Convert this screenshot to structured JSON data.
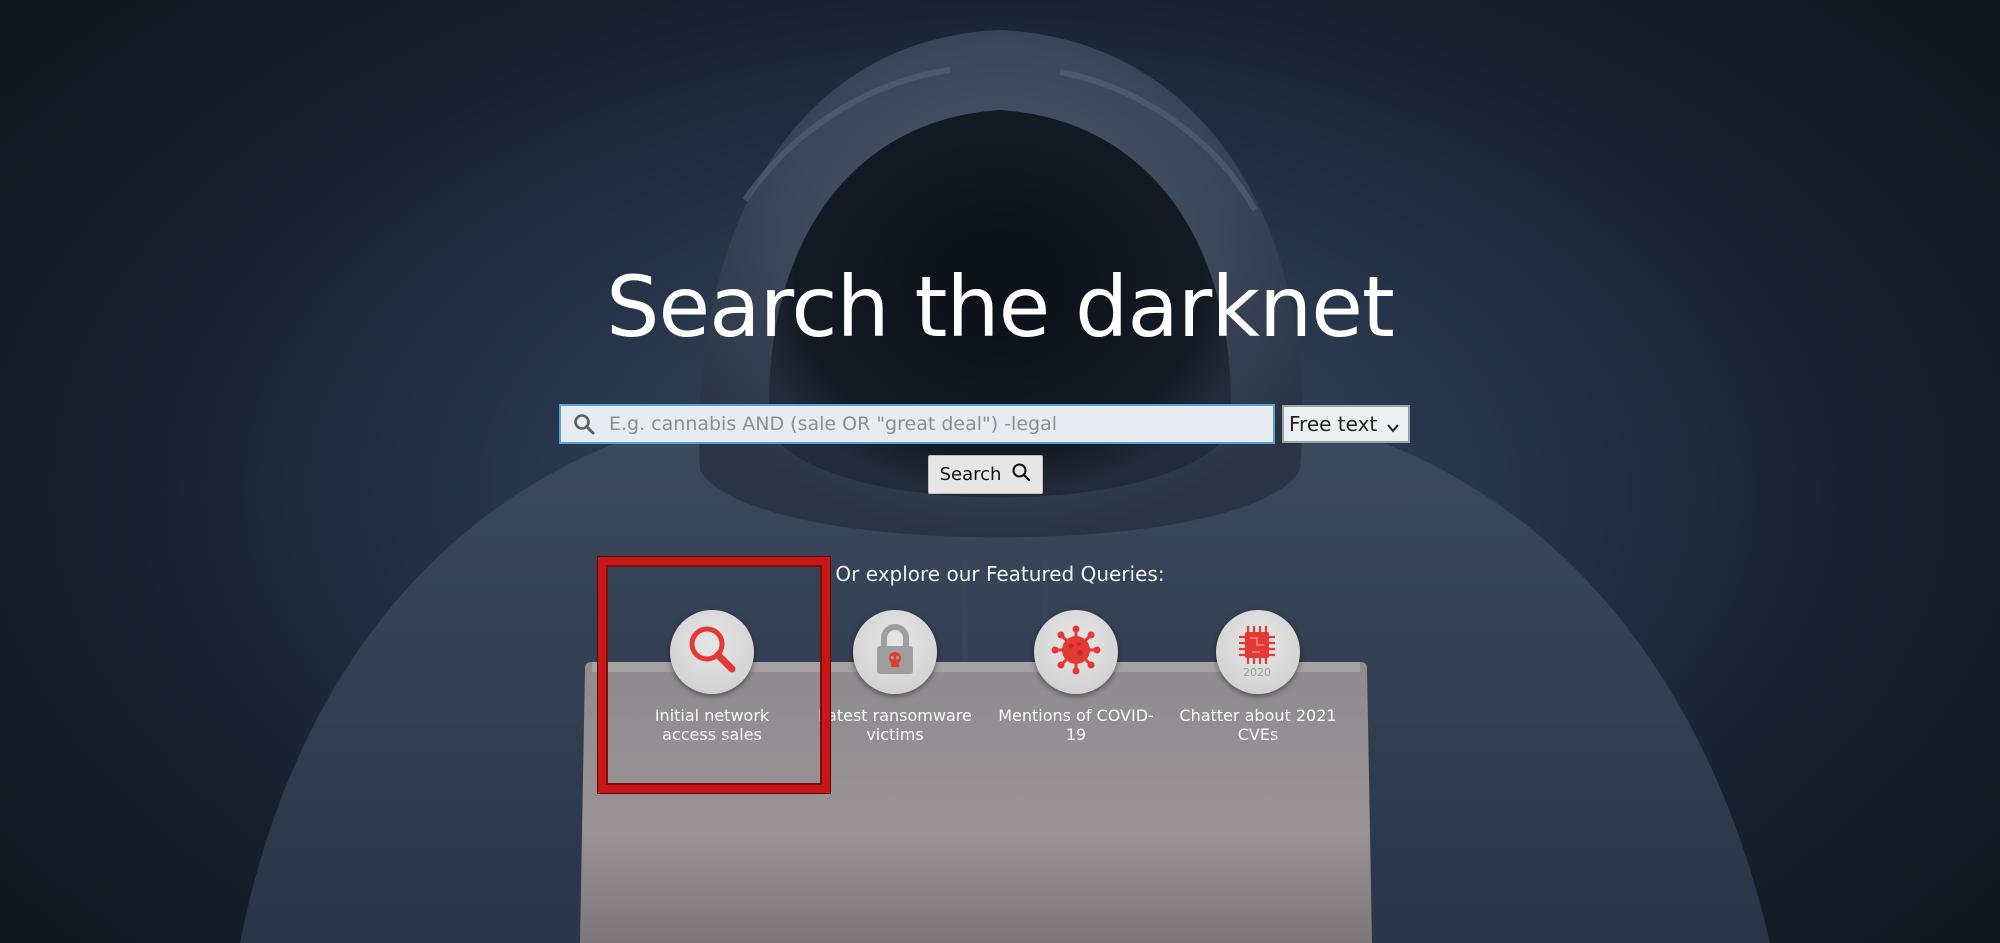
{
  "hero": {
    "title": "Search the darknet"
  },
  "search": {
    "placeholder": "E.g. cannabis AND (sale OR \"great deal\") -legal",
    "value": "",
    "type_selected": "Free text",
    "button_label": "Search"
  },
  "featured": {
    "heading": "Or explore our Featured Queries:",
    "queries": [
      {
        "label": "Initial network access sales",
        "icon": "magnifier-icon"
      },
      {
        "label": "Latest ransomware victims",
        "icon": "padlock-skull-icon"
      },
      {
        "label": "Mentions of COVID-19",
        "icon": "virus-icon"
      },
      {
        "label": "Chatter about 2021 CVEs",
        "icon": "chip-icon",
        "icon_text": "2020"
      }
    ]
  },
  "colors": {
    "accent_red": "#e53935",
    "highlight_border": "#c81717",
    "input_border": "#5aa0d8"
  }
}
